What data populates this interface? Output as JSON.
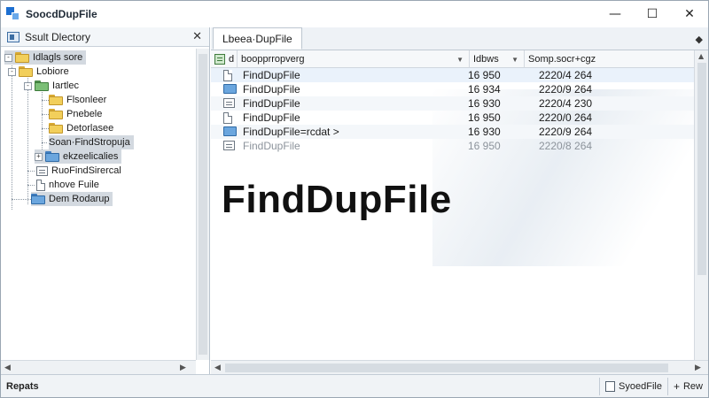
{
  "window": {
    "title": "SoocdDupFile",
    "controls": {
      "minimize": "—",
      "maximize": "☐",
      "close": "✕"
    }
  },
  "left_panel": {
    "header": "Ssult Dlectory",
    "close": "✕",
    "tree": [
      {
        "label": "Idlagls sore",
        "twisty": "-",
        "folder": "yellow",
        "selected": true
      },
      {
        "label": "Lobiore",
        "twisty": "-",
        "folder": "yellow",
        "selected": false
      },
      {
        "label": "Iartlec",
        "twisty": "-",
        "folder": "green",
        "selected": false
      },
      {
        "label": "Flsonleer",
        "twisty": "",
        "folder": "yellow",
        "selected": false
      },
      {
        "label": "Pnebele",
        "twisty": "",
        "folder": "yellow",
        "selected": false
      },
      {
        "label": "Detorlasee",
        "twisty": "",
        "folder": "yellow",
        "selected": false
      },
      {
        "label": "Soan·FindStropuja",
        "twisty": "",
        "folder": "",
        "selected": true
      },
      {
        "label": "ekzeelicalies",
        "twisty": "+",
        "folder": "blue",
        "selected": true
      },
      {
        "label": "RuoFindSirercal",
        "twisty": "",
        "folder": "",
        "selected": false
      },
      {
        "label": "nhove Fuile",
        "twisty": "",
        "folder": "",
        "selected": false
      },
      {
        "label": "Dem Rodarup",
        "twisty": "",
        "folder": "blue",
        "selected": true
      }
    ]
  },
  "right_panel": {
    "tab": "Lbeea·DupFile",
    "tab_menu": "◆",
    "columns": [
      {
        "label": "d"
      },
      {
        "label": "boopprropverg"
      },
      {
        "label": "Idbws"
      },
      {
        "label": "Somp.socr+cgz"
      }
    ],
    "rows": [
      {
        "icon": "doc",
        "name": "FindDupFile",
        "size": "16 950",
        "date": "2220/4 264"
      },
      {
        "icon": "folder",
        "name": "FindDupFile",
        "size": "16 934",
        "date": "2220/9 264"
      },
      {
        "icon": "lines",
        "name": "FindDupFile",
        "size": "16 930",
        "date": "2220/4 230"
      },
      {
        "icon": "doc",
        "name": "FindDupFile",
        "size": "16 950",
        "date": "2220/0 264"
      },
      {
        "icon": "folder",
        "name": "FindDupFile=rcdat >",
        "size": "16 930",
        "date": "2220/9 264"
      },
      {
        "icon": "lines",
        "name": "FindDupFile",
        "size": "16 950",
        "date": "2220/8 264"
      }
    ],
    "watermark": "FindDupFile"
  },
  "statusbar": {
    "left": "Repats",
    "btn1": "SyoedFile",
    "btn2": "Rew",
    "btn2_prefix": "+"
  }
}
